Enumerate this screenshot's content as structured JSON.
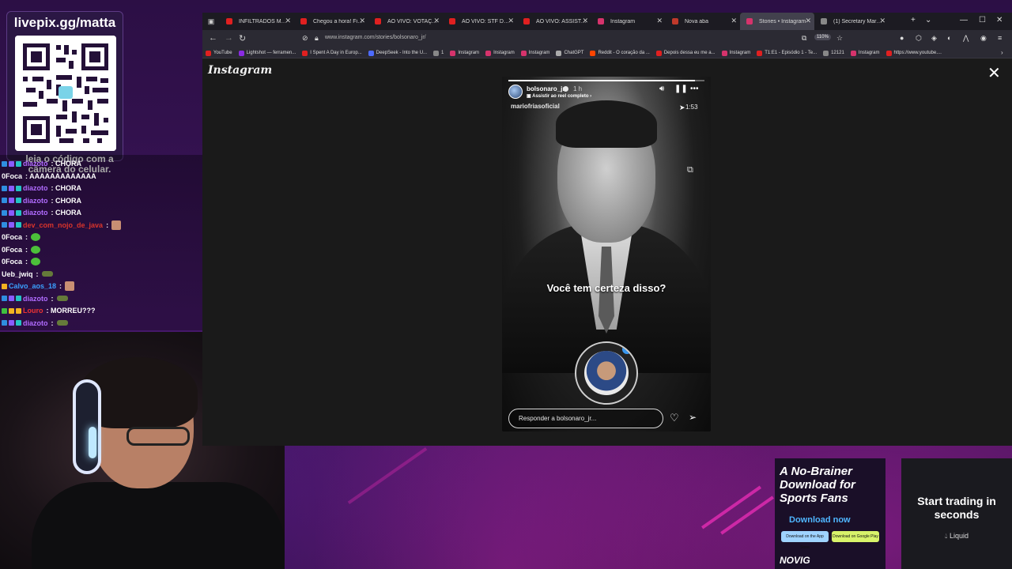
{
  "overlay": {
    "qr_title": "livepix.gg/matta",
    "qr_caption": "leia o código com a câmera do celular."
  },
  "chat": [
    {
      "user": "diazoto",
      "text": ": CHORA",
      "color": "#b16cff",
      "badges": [
        "blue",
        "purple",
        "teal"
      ],
      "emote": ""
    },
    {
      "user": "0Foca",
      "text": ": AAAAAAAAAAAAA",
      "color": "#ffffff",
      "badges": [],
      "emote": ""
    },
    {
      "user": "diazoto",
      "text": ": CHORA",
      "color": "#b16cff",
      "badges": [
        "blue",
        "purple",
        "teal"
      ],
      "emote": ""
    },
    {
      "user": "diazoto",
      "text": ": CHORA",
      "color": "#b16cff",
      "badges": [
        "blue",
        "purple",
        "teal"
      ],
      "emote": ""
    },
    {
      "user": "diazoto",
      "text": ": CHORA",
      "color": "#b16cff",
      "badges": [
        "blue",
        "purple",
        "teal"
      ],
      "emote": ""
    },
    {
      "user": "dev_com_nojo_de_java",
      "text": ":",
      "color": "#d9342b",
      "badges": [
        "blue",
        "purple",
        "teal"
      ],
      "emote": "img"
    },
    {
      "user": "0Foca",
      "text": ":",
      "color": "#ffffff",
      "badges": [],
      "emote": "green"
    },
    {
      "user": "0Foca",
      "text": ":",
      "color": "#ffffff",
      "badges": [],
      "emote": "green"
    },
    {
      "user": "0Foca",
      "text": ":",
      "color": "#ffffff",
      "badges": [],
      "emote": "green"
    },
    {
      "user": "Ueb_jwiq",
      "text": ":",
      "color": "#ffffff",
      "badges": [],
      "emote": "gray"
    },
    {
      "user": "Calvo_aos_18",
      "text": ":",
      "color": "#3aa0ff",
      "badges": [
        "gold"
      ],
      "emote": "img"
    },
    {
      "user": "diazoto",
      "text": ":",
      "color": "#b16cff",
      "badges": [
        "blue",
        "purple",
        "teal"
      ],
      "emote": "gray"
    },
    {
      "user": "Louro",
      "text": ": MORREU???",
      "color": "#e33",
      "badges": [
        "green",
        "gold",
        "gold"
      ],
      "emote": ""
    },
    {
      "user": "diazoto",
      "text": ":",
      "color": "#b16cff",
      "badges": [
        "blue",
        "purple",
        "teal"
      ],
      "emote": "gray"
    }
  ],
  "browser": {
    "tabs": [
      {
        "label": "INFILTRADOS MOSTRA...",
        "color": "#e02020",
        "active": false
      },
      {
        "label": "Chegou a hora! Finalm...",
        "color": "#e02020",
        "active": false
      },
      {
        "label": "AO VIVO: VOTAÇÃO D...",
        "color": "#e02020",
        "active": false
      },
      {
        "label": "AO VIVO: STF DEFINE F...",
        "color": "#e02020",
        "active": false
      },
      {
        "label": "AO VIVO: ASSISTA: Bol...",
        "color": "#e02020",
        "active": false
      },
      {
        "label": "Instagram",
        "color": "#d6336c",
        "active": false
      },
      {
        "label": "Nova aba",
        "color": "#c0392b",
        "active": false
      },
      {
        "label": "Stories • Instagram",
        "color": "#d6336c",
        "active": true
      },
      {
        "label": "(1) Secretary Marco Ru...",
        "color": "#888888",
        "active": false
      }
    ],
    "url": "www.instagram.com/stories/bolsonaro_jr/",
    "zoom": "110%",
    "bookmarks": [
      {
        "label": "YouTube",
        "color": "#e02020"
      },
      {
        "label": "Lightshot — ferramen...",
        "color": "#8a2be2"
      },
      {
        "label": "I Spent A Day in Europ...",
        "color": "#e02020"
      },
      {
        "label": "DeepSeek - Into the U...",
        "color": "#4d6bfe"
      },
      {
        "label": "1",
        "color": "#888888"
      },
      {
        "label": "Instagram",
        "color": "#d6336c"
      },
      {
        "label": "Instagram",
        "color": "#d6336c"
      },
      {
        "label": "Instagram",
        "color": "#d6336c"
      },
      {
        "label": "ChatGPT",
        "color": "#aaaaaa"
      },
      {
        "label": "Reddit - O coração da ...",
        "color": "#ff4500"
      },
      {
        "label": "Depois dessa eu me a...",
        "color": "#e02020"
      },
      {
        "label": "Instagram",
        "color": "#d6336c"
      },
      {
        "label": "T1:E1 - Episódio 1 - Te...",
        "color": "#e02020"
      },
      {
        "label": "12121",
        "color": "#888888"
      },
      {
        "label": "Instagram",
        "color": "#d6336c"
      },
      {
        "label": "https://www.youtube....",
        "color": "#e02020"
      }
    ]
  },
  "instagram": {
    "logo": "Instagram",
    "story": {
      "username": "bolsonaro_jr",
      "time": "1 h",
      "reel_link": "Assistir ao reel completo",
      "subtag": "mariofriasoficial",
      "duration": "1:53",
      "caption": "Você tem certeza disso?",
      "reply_placeholder": "Responder a bolsonaro_jr...",
      "progress": 0.95
    }
  },
  "ads": {
    "ad1_title": "A No-Brainer Download for Sports Fans",
    "ad1_cta": "Download now",
    "ad1_appstore": "Download on the App Store",
    "ad1_googleplay": "Download on Google Play",
    "ad1_brand": "NOVIG",
    "ad2_title": "Start trading in seconds",
    "ad2_brand": "Liquid"
  }
}
